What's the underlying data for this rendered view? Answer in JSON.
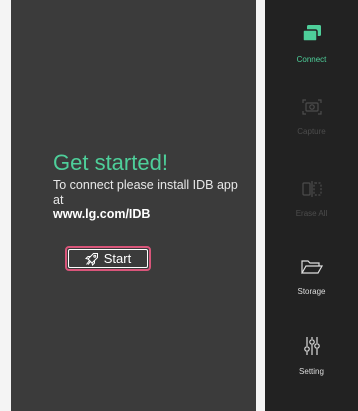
{
  "main": {
    "title": "Get started!",
    "description": "To connect please install IDB app at",
    "url": "www.lg.com/IDB",
    "start_button_label": "Start"
  },
  "sidebar": {
    "items": [
      {
        "label": "Connect",
        "icon": "connect-icon",
        "state": "active"
      },
      {
        "label": "Capture",
        "icon": "capture-icon",
        "state": "disabled"
      },
      {
        "label": "Erase All",
        "icon": "erase-icon",
        "state": "disabled"
      },
      {
        "label": "Storage",
        "icon": "folder-icon",
        "state": "enabled"
      },
      {
        "label": "Setting",
        "icon": "settings-sliders-icon",
        "state": "enabled"
      }
    ]
  },
  "colors": {
    "accent": "#4ecf9a",
    "button_border": "#d9557a",
    "panel_bg": "#3b3b3b",
    "sidebar_bg": "#222222"
  }
}
